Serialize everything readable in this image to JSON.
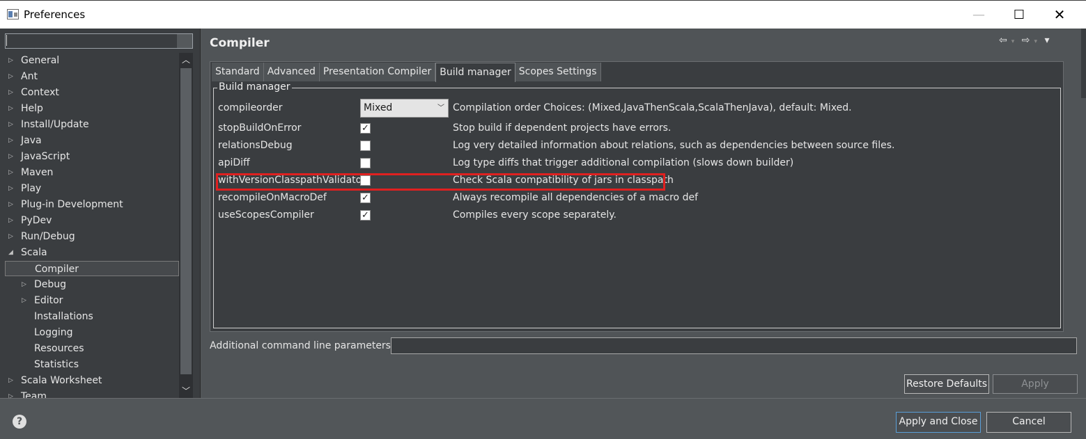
{
  "window": {
    "title": "Preferences",
    "minimize": "—",
    "maximize": "☐",
    "close": "✕"
  },
  "tree": {
    "items": [
      {
        "label": "General",
        "level": 0,
        "twisty": "▷"
      },
      {
        "label": "Ant",
        "level": 0,
        "twisty": "▷"
      },
      {
        "label": "Context",
        "level": 0,
        "twisty": "▷"
      },
      {
        "label": "Help",
        "level": 0,
        "twisty": "▷"
      },
      {
        "label": "Install/Update",
        "level": 0,
        "twisty": "▷"
      },
      {
        "label": "Java",
        "level": 0,
        "twisty": "▷"
      },
      {
        "label": "JavaScript",
        "level": 0,
        "twisty": "▷"
      },
      {
        "label": "Maven",
        "level": 0,
        "twisty": "▷"
      },
      {
        "label": "Play",
        "level": 0,
        "twisty": "▷"
      },
      {
        "label": "Plug-in Development",
        "level": 0,
        "twisty": "▷"
      },
      {
        "label": "PyDev",
        "level": 0,
        "twisty": "▷"
      },
      {
        "label": "Run/Debug",
        "level": 0,
        "twisty": "▷"
      },
      {
        "label": "Scala",
        "level": 0,
        "twisty": "◢"
      },
      {
        "label": "Compiler",
        "level": 1,
        "twisty": "",
        "selected": true
      },
      {
        "label": "Debug",
        "level": 1,
        "twisty": "▷"
      },
      {
        "label": "Editor",
        "level": 1,
        "twisty": "▷"
      },
      {
        "label": "Installations",
        "level": 1,
        "twisty": ""
      },
      {
        "label": "Logging",
        "level": 1,
        "twisty": ""
      },
      {
        "label": "Resources",
        "level": 1,
        "twisty": ""
      },
      {
        "label": "Statistics",
        "level": 1,
        "twisty": ""
      },
      {
        "label": "Scala Worksheet",
        "level": 0,
        "twisty": "▷"
      },
      {
        "label": "Team",
        "level": 0,
        "twisty": "▷"
      }
    ]
  },
  "page": {
    "title": "Compiler",
    "nav": {
      "back": "⇦",
      "forward": "⇨",
      "menu": "▾",
      "dropdown": "▾"
    }
  },
  "tabs": [
    {
      "label": "Standard",
      "active": false
    },
    {
      "label": "Advanced",
      "active": false
    },
    {
      "label": "Presentation Compiler",
      "active": false
    },
    {
      "label": "Build manager",
      "active": true
    },
    {
      "label": "Scopes Settings",
      "active": false
    }
  ],
  "group": {
    "label": "Build manager"
  },
  "settings": [
    {
      "name": "compileorder",
      "type": "select",
      "value": "Mixed",
      "description": "Compilation order Choices: (Mixed,JavaThenScala,ScalaThenJava), default: Mixed."
    },
    {
      "name": "stopBuildOnError",
      "type": "checkbox",
      "checked": true,
      "check": "✓",
      "description": "Stop build if dependent projects have errors."
    },
    {
      "name": "relationsDebug",
      "type": "checkbox",
      "checked": false,
      "check": "",
      "description": "Log very detailed information about relations, such as dependencies between source files."
    },
    {
      "name": "apiDiff",
      "type": "checkbox",
      "checked": false,
      "check": "",
      "description": "Log type diffs that trigger additional compilation (slows down builder)"
    },
    {
      "name": "withVersionClasspathValidator",
      "type": "checkbox",
      "checked": false,
      "check": "",
      "description": "Check Scala compatibility of jars in classpath"
    },
    {
      "name": "recompileOnMacroDef",
      "type": "checkbox",
      "checked": true,
      "check": "✓",
      "description": "Always recompile all dependencies of a macro def"
    },
    {
      "name": "useScopesCompiler",
      "type": "checkbox",
      "checked": true,
      "check": "✓",
      "description": "Compiles every scope separately."
    }
  ],
  "additional": {
    "label": "Additional command line parameters:",
    "value": ""
  },
  "buttons": {
    "restore_defaults": "Restore Defaults",
    "apply": "Apply",
    "apply_and_close": "Apply and Close",
    "cancel": "Cancel",
    "help": "?"
  },
  "colors": {
    "highlight": "#e02020",
    "accent": "#5a9fd8"
  }
}
